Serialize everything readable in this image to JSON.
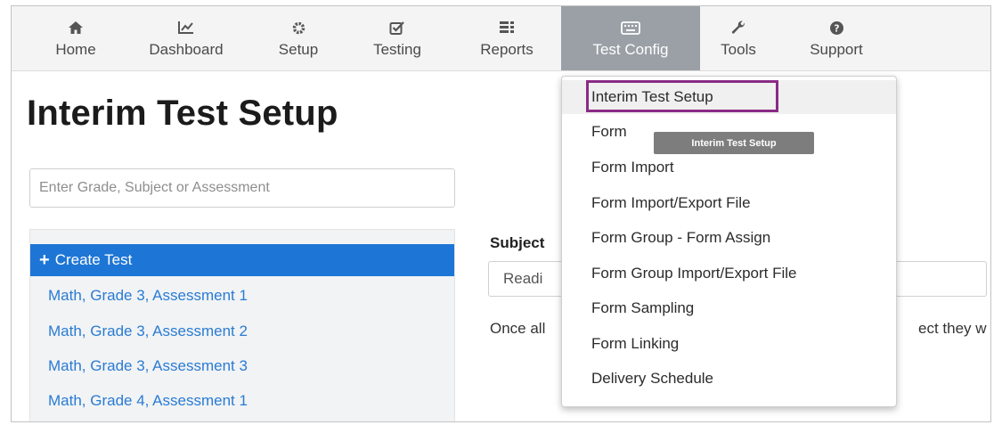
{
  "nav": {
    "items": [
      {
        "label": "Home",
        "icon": "home-icon"
      },
      {
        "label": "Dashboard",
        "icon": "chart-icon"
      },
      {
        "label": "Setup",
        "icon": "gear-icon"
      },
      {
        "label": "Testing",
        "icon": "checkbox-icon"
      },
      {
        "label": "Reports",
        "icon": "reports-icon"
      },
      {
        "label": "Test Config",
        "icon": "keyboard-icon",
        "active": true
      },
      {
        "label": "Tools",
        "icon": "wrench-icon"
      },
      {
        "label": "Support",
        "icon": "question-icon"
      }
    ]
  },
  "page": {
    "title": "Interim Test Setup",
    "search_placeholder": "Enter Grade, Subject or Assessment"
  },
  "tests": {
    "create_label": "Create Test",
    "items": [
      "Math, Grade 3, Assessment 1",
      "Math, Grade 3, Assessment 2",
      "Math, Grade 3, Assessment 3",
      "Math, Grade 4, Assessment 1"
    ]
  },
  "form": {
    "subject_label": "Subject",
    "subject_value": "Readi",
    "once_text": "Once all",
    "once_tail": "ect they w"
  },
  "dropdown": {
    "items": [
      "Interim Test Setup",
      "Form",
      "Form Import",
      "Form Import/Export File",
      "Form Group - Form Assign",
      "Form Group Import/Export File",
      "Form Sampling",
      "Form Linking",
      "Delivery Schedule"
    ],
    "tooltip": "Interim Test Setup"
  },
  "colors": {
    "accent": "#1d76d6",
    "link": "#2a7bd2",
    "nav_active": "#9aa0a6",
    "highlight_border": "#8a2b86"
  }
}
